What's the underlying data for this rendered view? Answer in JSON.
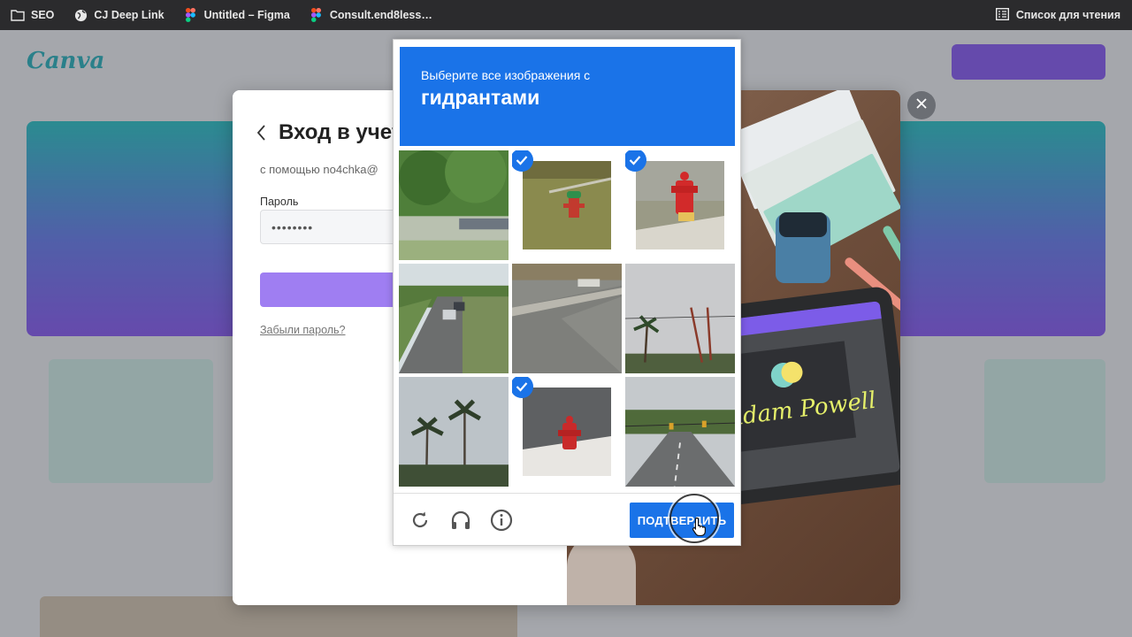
{
  "bookmarks": [
    {
      "label": "SEO",
      "icon": "folder-icon"
    },
    {
      "label": "CJ Deep Link",
      "icon": "globe-icon"
    },
    {
      "label": "Untitled – Figma",
      "icon": "figma-icon"
    },
    {
      "label": "Consult.end8less…",
      "icon": "figma-icon"
    }
  ],
  "reading_list": {
    "label": "Список для чтения",
    "icon": "reading-list-icon"
  },
  "login": {
    "title": "Вход в учет",
    "subtitle": "с помощью no4chka@",
    "password_label": "Пароль",
    "password_value": "••••••••",
    "forgot_link": "Забыли пароль?"
  },
  "tablet_signature": "Adam Powell",
  "captcha": {
    "instruction": "Выберите все изображения с",
    "target": "гидрантами",
    "verify_label": "ПОДТВЕРДИТЬ",
    "tiles": [
      {
        "scene": "trees-parking",
        "selected": false
      },
      {
        "scene": "hydrant-grass",
        "selected": true
      },
      {
        "scene": "hydrant-sidewalk",
        "selected": true
      },
      {
        "scene": "road-cars",
        "selected": false
      },
      {
        "scene": "street-corner",
        "selected": false
      },
      {
        "scene": "palm-wires",
        "selected": false
      },
      {
        "scene": "palm-trees",
        "selected": false
      },
      {
        "scene": "hydrant-curb",
        "selected": true
      },
      {
        "scene": "road-traffic-lights",
        "selected": false
      }
    ]
  },
  "colors": {
    "captcha_blue": "#1a73e8",
    "brand_purple": "#8b5cf6"
  }
}
